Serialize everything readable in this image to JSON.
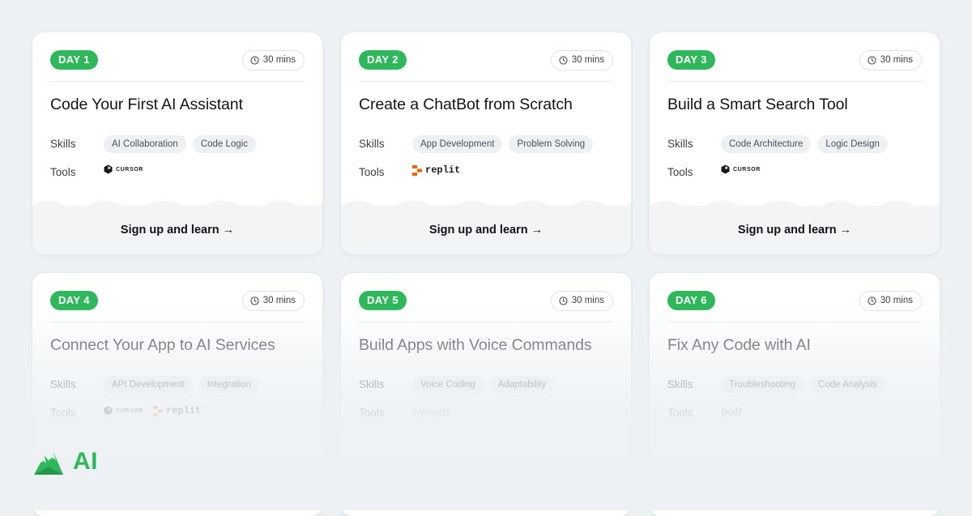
{
  "cards": [
    {
      "day": "DAY 1",
      "duration": "30 mins",
      "title": "Code Your First AI Assistant",
      "skills_label": "Skills",
      "tools_label": "Tools",
      "skills": [
        "AI Collaboration",
        "Code Logic"
      ],
      "tools": [
        {
          "name": "CURSOR",
          "icon": "cursor-logo"
        }
      ],
      "cta": "Sign up and learn",
      "cta_arrow": "→"
    },
    {
      "day": "DAY 2",
      "duration": "30 mins",
      "title": "Create a ChatBot from Scratch",
      "skills_label": "Skills",
      "tools_label": "Tools",
      "skills": [
        "App Development",
        "Problem Solving"
      ],
      "tools": [
        {
          "name": "replit",
          "icon": "replit-logo"
        }
      ],
      "cta": "Sign up and learn",
      "cta_arrow": "→"
    },
    {
      "day": "DAY 3",
      "duration": "30 mins",
      "title": "Build a Smart Search Tool",
      "skills_label": "Skills",
      "tools_label": "Tools",
      "skills": [
        "Code Architecture",
        "Logic Design"
      ],
      "tools": [
        {
          "name": "CURSOR",
          "icon": "cursor-logo"
        }
      ],
      "cta": "Sign up and learn",
      "cta_arrow": "→"
    },
    {
      "day": "DAY 4",
      "duration": "30 mins",
      "title": "Connect Your App to AI Services",
      "skills_label": "Skills",
      "tools_label": "Tools",
      "skills": [
        "API Development",
        "Integration"
      ],
      "tools": [
        {
          "name": "CURSOR",
          "icon": "cursor-logo"
        },
        {
          "name": "replit",
          "icon": "replit-logo"
        }
      ]
    },
    {
      "day": "DAY 5",
      "duration": "30 mins",
      "title": "Build Apps with Voice Commands",
      "skills_label": "Skills",
      "tools_label": "Tools",
      "skills": [
        "Voice Coding",
        "Adaptability"
      ],
      "tools": [
        {
          "name": "weweb",
          "icon": "weweb-logo"
        }
      ]
    },
    {
      "day": "DAY 6",
      "duration": "30 mins",
      "title": "Fix Any Code with AI",
      "skills_label": "Skills",
      "tools_label": "Tools",
      "skills": [
        "Troubleshooting",
        "Code Analysis"
      ],
      "tools": [
        {
          "name": "bolt",
          "icon": "bolt-logo"
        }
      ]
    }
  ],
  "brand": {
    "text": "AI",
    "icon": "mountain-logo"
  },
  "colors": {
    "accent": "#2fb85b",
    "background": "#edf1f4",
    "card": "#ffffff"
  }
}
